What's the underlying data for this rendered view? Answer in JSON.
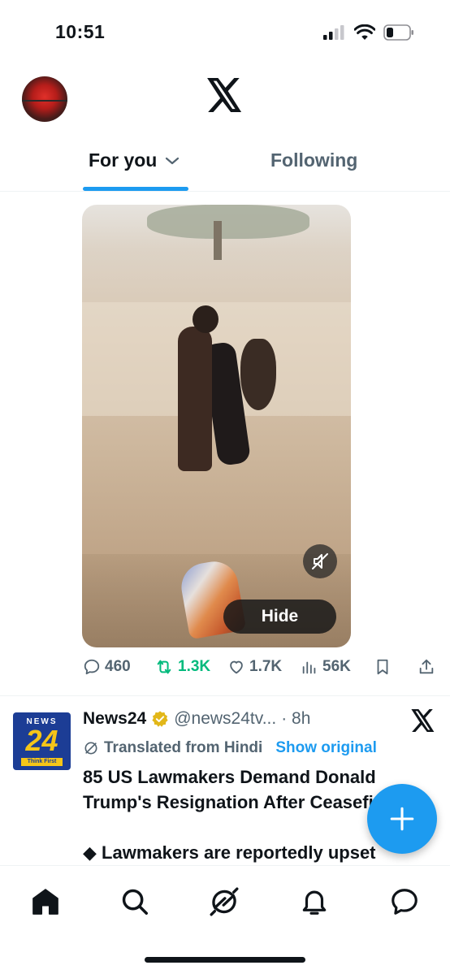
{
  "status_bar": {
    "time": "10:51"
  },
  "header": {
    "logo": "x-logo"
  },
  "tabs": [
    {
      "label": "For you",
      "active": true
    },
    {
      "label": "Following",
      "active": false
    }
  ],
  "video_post": {
    "hide_label": "Hide",
    "muted": true
  },
  "actions": {
    "replies": "460",
    "reposts": "1.3K",
    "likes": "1.7K",
    "views": "56K"
  },
  "post": {
    "author": "News24",
    "handle": "@news24tv...",
    "time": "· 8h",
    "avatar_text": {
      "top": "NEWS",
      "number": "24",
      "tagline": "Think First"
    },
    "translated_label": "Translated from Hindi",
    "show_original": "Show original",
    "text_line1": "85 US Lawmakers Demand Donald",
    "text_line2": "Trump's Resignation After Ceasefire",
    "text_line3": "◆ Lawmakers are reportedly upset"
  },
  "colors": {
    "accent": "#1d9bf0",
    "repost_green": "#00ba7c",
    "secondary_text": "#536471",
    "primary_text": "#0f1419"
  },
  "bottom_nav": [
    "home-icon",
    "search-icon",
    "grok-icon",
    "notifications-icon",
    "messages-icon"
  ]
}
